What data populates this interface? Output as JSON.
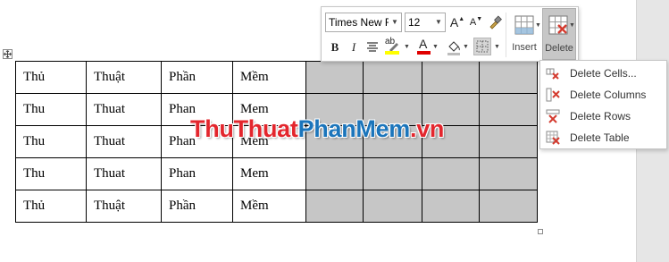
{
  "table": {
    "rows": [
      [
        "Thủ",
        "Thuật",
        "Phần",
        "Mềm",
        "",
        "",
        "",
        ""
      ],
      [
        "Thu",
        "Thuat",
        "Phan",
        "Mem",
        "",
        "",
        "",
        ""
      ],
      [
        "Thu",
        "Thuat",
        "Phan",
        "Mem",
        "",
        "",
        "",
        ""
      ],
      [
        "Thu",
        "Thuat",
        "Phan",
        "Mem",
        "",
        "",
        "",
        ""
      ],
      [
        "Thủ",
        "Thuật",
        "Phần",
        "Mềm",
        "",
        "",
        "",
        ""
      ]
    ],
    "selected_columns": [
      4,
      5,
      6,
      7
    ],
    "selection_color": "#c6c6c6"
  },
  "watermark": {
    "part1": "ThuThuat",
    "part2": "PhanMem",
    "part3": ".vn",
    "color_red": "#e3262d",
    "color_blue": "#1b75bb"
  },
  "mini_toolbar": {
    "font_name": "Times New Ro",
    "font_size": "12",
    "bold_label": "B",
    "italic_label": "I",
    "grow_font_label": "A",
    "shrink_font_label": "A",
    "highlight_label": "ab",
    "font_color_label": "A",
    "highlight_color": "#ffff00",
    "font_color": "#e00000",
    "insert_label": "Insert",
    "delete_label": "Delete"
  },
  "delete_menu": {
    "items": [
      {
        "label": "Delete Cells...",
        "icon": "delete-cells-icon"
      },
      {
        "label": "Delete Columns",
        "icon": "delete-columns-icon"
      },
      {
        "label": "Delete Rows",
        "icon": "delete-rows-icon"
      },
      {
        "label": "Delete Table",
        "icon": "delete-table-icon"
      }
    ]
  }
}
